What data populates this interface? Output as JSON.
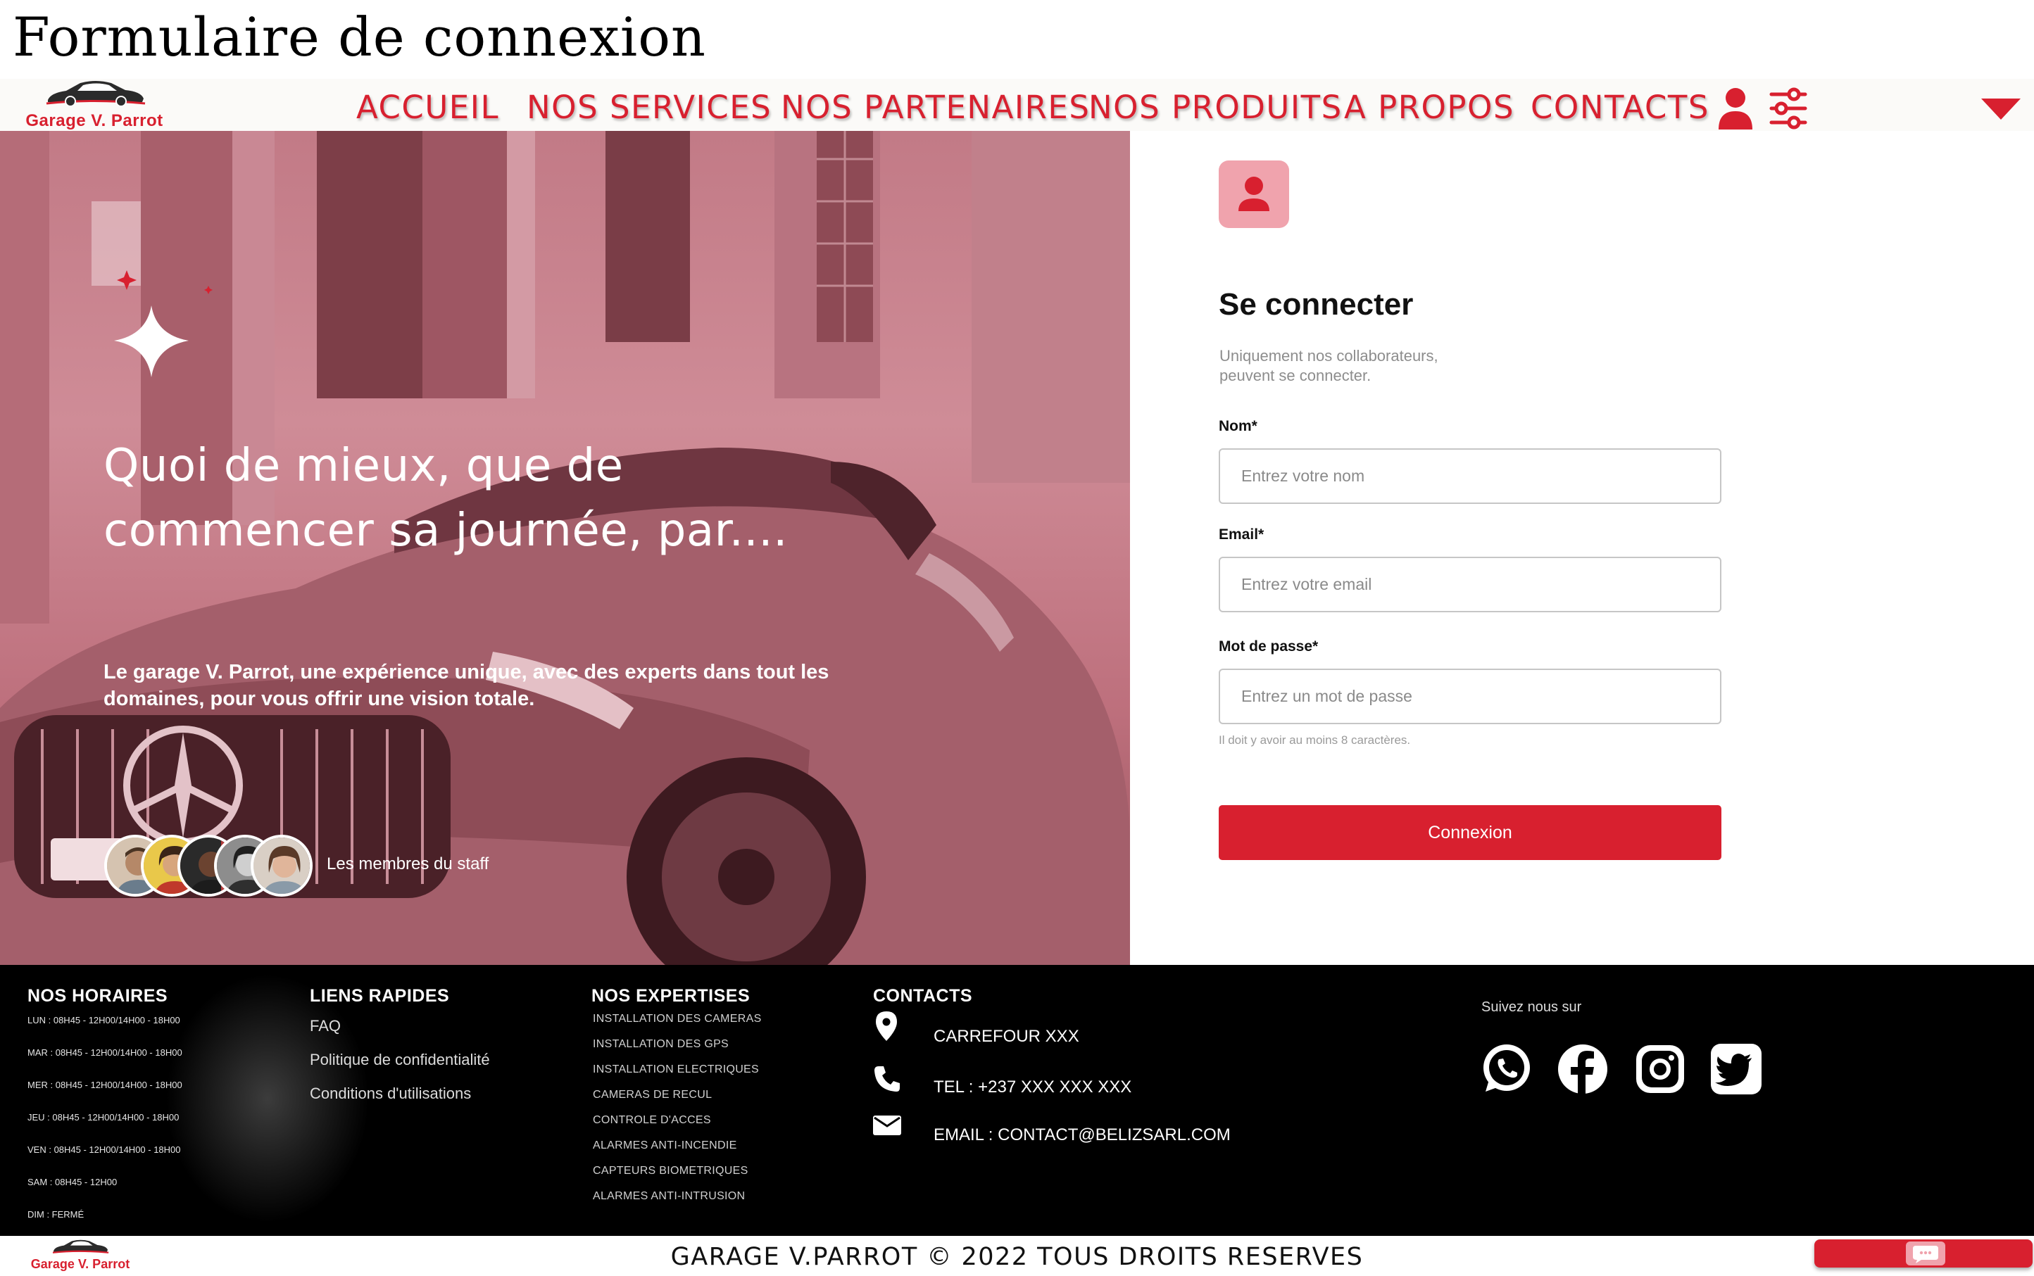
{
  "page": {
    "title": "Formulaire de connexion"
  },
  "brand": {
    "name": "Garage V. Parrot",
    "accent": "#d8202f",
    "accent_light": "#f0a3ad"
  },
  "nav": {
    "items": [
      {
        "label": "ACCUEIL"
      },
      {
        "label": "NOS SERVICES"
      },
      {
        "label": "NOS PARTENAIRES"
      },
      {
        "label": "NOS PRODUITS"
      },
      {
        "label": "A PROPOS"
      },
      {
        "label": "CONTACTS"
      }
    ],
    "icons": [
      "user-icon",
      "sliders-icon",
      "caret-down-icon"
    ]
  },
  "hero": {
    "headline_line1": "Quoi de mieux, que de",
    "headline_line2": "commencer sa journée, par....",
    "description": "Le garage V. Parrot, une expérience unique, avec des experts dans tout les domaines, pour vous offrir une vision totale.",
    "staff_label": "Les membres du staff",
    "staff_count": 5
  },
  "login": {
    "heading": "Se connecter",
    "subtitle_line1": "Uniquement nos collaborateurs,",
    "subtitle_line2": "peuvent se connecter.",
    "fields": [
      {
        "label": "Nom*",
        "placeholder": "Entrez votre nom"
      },
      {
        "label": "Email*",
        "placeholder": "Entrez votre email"
      },
      {
        "label": "Mot de passe*",
        "placeholder": "Entrez un mot de passe"
      }
    ],
    "password_hint": "Il doit y avoir au moins 8 caractères.",
    "submit_label": "Connexion"
  },
  "footer": {
    "hours": {
      "heading": "NOS HORAIRES",
      "lines": [
        "LUN  : 08H45 - 12H00/14H00 - 18H00",
        "MAR : 08H45 - 12H00/14H00 - 18H00",
        "MER : 08H45 - 12H00/14H00 - 18H00",
        "JEU  : 08H45 - 12H00/14H00 - 18H00",
        "VEN  : 08H45 - 12H00/14H00 - 18H00",
        "SAM : 08H45 - 12H00",
        "DIM  : FERMÉ"
      ]
    },
    "links": {
      "heading": "LIENS RAPIDES",
      "items": [
        "FAQ",
        "Politique de confidentialité",
        "Conditions d'utilisations"
      ]
    },
    "expertises": {
      "heading": "NOS EXPERTISES",
      "items": [
        "INSTALLATION DES CAMERAS",
        "INSTALLATION DES GPS",
        "INSTALLATION ELECTRIQUES",
        "CAMERAS DE RECUL",
        "CONTROLE D'ACCES",
        "ALARMES ANTI-INCENDIE",
        "CAPTEURS BIOMETRIQUES",
        "ALARMES ANTI-INTRUSION"
      ]
    },
    "contacts": {
      "heading": "CONTACTS",
      "address": "CARREFOUR XXX",
      "phone": "TEL : +237 XXX XXX XXX",
      "email": "EMAIL : CONTACT@BELIZSARL.COM"
    },
    "social": {
      "label": "Suivez nous sur",
      "networks": [
        "whatsapp-icon",
        "facebook-icon",
        "instagram-icon",
        "twitter-icon"
      ]
    }
  },
  "bottom": {
    "brand": "Garage V. Parrot",
    "copyright": "GARAGE V.PARROT © 2022 TOUS DROITS RESERVES"
  }
}
